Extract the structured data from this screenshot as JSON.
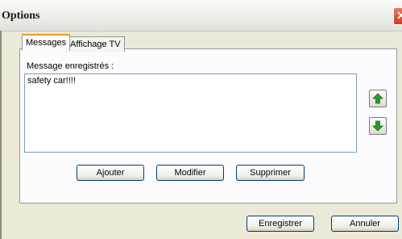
{
  "window": {
    "title": "Options",
    "close_glyph": "✕"
  },
  "tabs": [
    {
      "label": "Messages",
      "active": true
    },
    {
      "label": "Affichage TV",
      "active": false
    }
  ],
  "messages": {
    "label": "Message enregistrés :",
    "items": [
      "safety car!!!!"
    ]
  },
  "buttons": {
    "add": "Ajouter",
    "modify": "Modifier",
    "delete": "Supprimer",
    "save": "Enregistrer",
    "cancel": "Annuler"
  },
  "icons": {
    "up": "arrow-up-icon",
    "down": "arrow-down-icon",
    "accent_green": "#2e9a2e"
  }
}
